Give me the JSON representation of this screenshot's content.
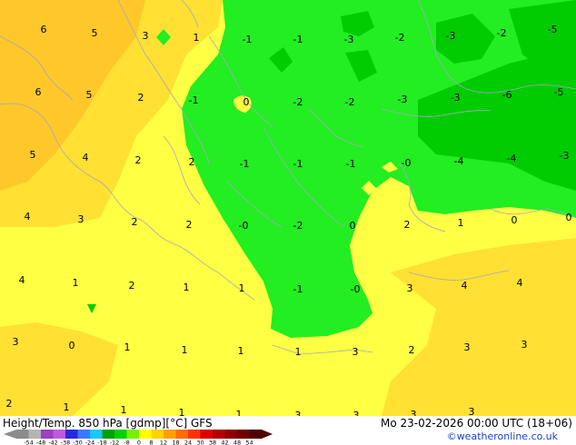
{
  "map": {
    "colors": {
      "green": "#22ee22",
      "dark_green": "#00cc00",
      "yellow": "#ffff44",
      "light_orange": "#ffe033",
      "orange": "#ffc82a",
      "sea_lines": "#a6a6c6"
    },
    "values": [
      "6",
      "5",
      "3",
      "1",
      "-1",
      "-1",
      "-3",
      "-2",
      "-3",
      "-2",
      "-5",
      "6",
      "5",
      "2",
      "-1",
      "0",
      "-2",
      "-2",
      "-3",
      "-3",
      "-6",
      "-5",
      "5",
      "4",
      "2",
      "2",
      "-1",
      "-1",
      "-1",
      "-0",
      "-4",
      "-4",
      "-3",
      "4",
      "3",
      "2",
      "2",
      "-0",
      "-2",
      "0",
      "2",
      "1",
      "0",
      "0",
      "4",
      "1",
      "2",
      "1",
      "1",
      "-1",
      "-0",
      "3",
      "4",
      "4",
      "3",
      "0",
      "1",
      "1",
      "1",
      "1",
      "3",
      "2",
      "3",
      "3",
      "2",
      "1",
      "1",
      "1",
      "1",
      "3",
      "3",
      "3",
      "3"
    ]
  },
  "footer": {
    "title": "Height/Temp. 850 hPa [gdmp][°C] GFS",
    "datetime": "Mo 23-02-2026 00:00 UTC (18+06)",
    "credit": "©weatheronline.co.uk",
    "legend_labels": [
      "-54",
      "-48",
      "-42",
      "-38",
      "-30",
      "-24",
      "-18",
      "-12",
      "-8",
      "0",
      "8",
      "12",
      "18",
      "24",
      "30",
      "38",
      "42",
      "48",
      "54"
    ],
    "legend_colors": [
      "#8c8c8c",
      "#b4b4b4",
      "#9b3fbf",
      "#c05adc",
      "#2828dc",
      "#3c78ff",
      "#18c8ff",
      "#00a000",
      "#00d200",
      "#78f000",
      "#ffff00",
      "#ffd200",
      "#ffa000",
      "#ff6e00",
      "#ff3200",
      "#dc0000",
      "#b40000",
      "#8c0000",
      "#6e0000",
      "#500000"
    ]
  }
}
